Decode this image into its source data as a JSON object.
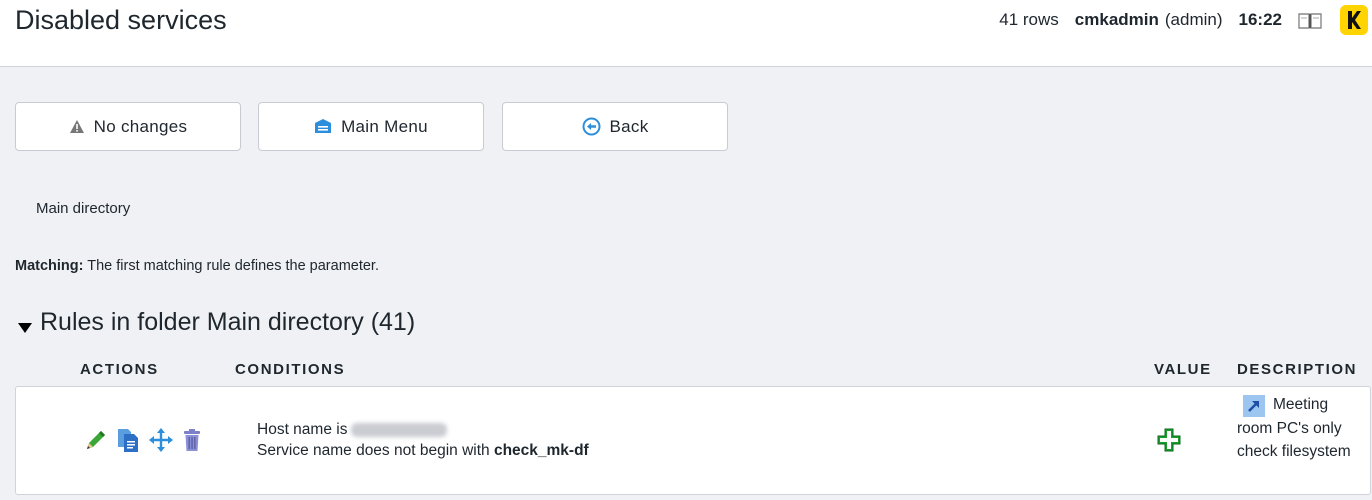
{
  "header": {
    "title": "Disabled services",
    "rows": "41 rows",
    "user": "cmkadmin",
    "role": "(admin)",
    "time": "16:22"
  },
  "toolbar": {
    "no_changes": "No changes",
    "main_menu": "Main Menu",
    "back": "Back"
  },
  "breadcrumb": "Main directory",
  "matching": {
    "label": "Matching:",
    "text": " The first matching rule defines the parameter."
  },
  "folder": {
    "title": "Rules in folder Main directory (41)"
  },
  "columns": {
    "actions": "ACTIONS",
    "conditions": "CONDITIONS",
    "value": "VALUE",
    "description": "DESCRIPTION"
  },
  "rules": [
    {
      "cond_host": "Host name is",
      "cond_service_prefix": "Service name does not begin with ",
      "cond_service_value": "check_mk-df",
      "description": "Meeting room PC's only check filesystem"
    }
  ],
  "colors": {
    "accent_green": "#1a9e2e",
    "accent_blue": "#2d8fdb",
    "logo_yellow": "#ffd400"
  },
  "icons": [
    "book-icon",
    "logo-icon",
    "warning-icon",
    "main-menu-icon",
    "back-icon",
    "edit-icon",
    "clone-icon",
    "move-icon",
    "delete-icon",
    "value-plus-icon",
    "rule-link-icon"
  ]
}
